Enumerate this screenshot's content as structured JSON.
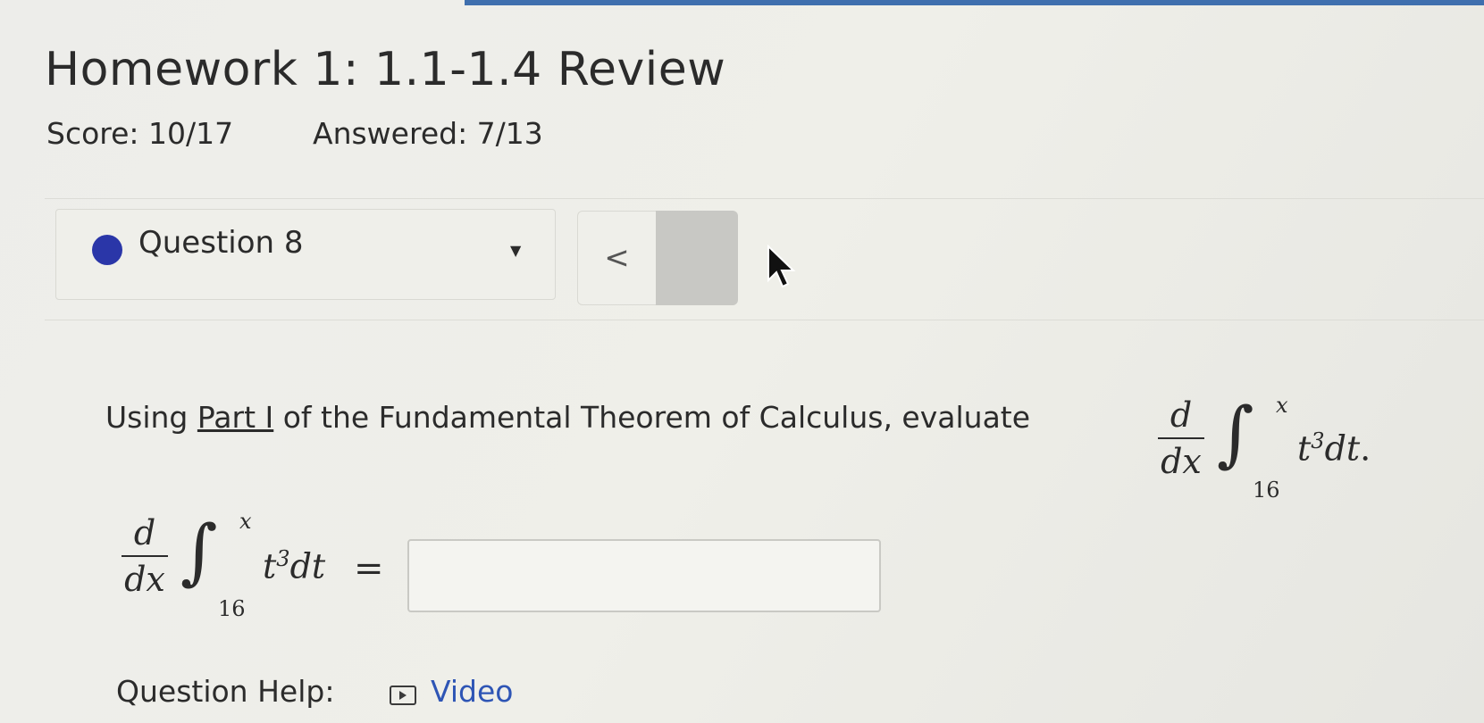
{
  "page": {
    "title": "Homework 1: 1.1-1.4 Review",
    "score": "Score: 10/17",
    "answered": "Answered: 7/13"
  },
  "question_nav": {
    "selected": "Question 8",
    "prev_label": "<"
  },
  "question": {
    "prompt_prefix": "Using ",
    "prompt_link": "Part I",
    "prompt_suffix": " of the Fundamental Theorem of Calculus, evaluate",
    "expression": {
      "d": "d",
      "dx": "dx",
      "upper": "x",
      "lower": "16",
      "base": "t",
      "exp": "3",
      "diff": "dt",
      "period": ".",
      "equals": "="
    },
    "answer_value": ""
  },
  "help": {
    "label": "Question Help:",
    "video": "Video"
  },
  "colors": {
    "status_dot": "#2a36a8",
    "link": "#2e55b5",
    "topbar": "#3f6fae"
  }
}
